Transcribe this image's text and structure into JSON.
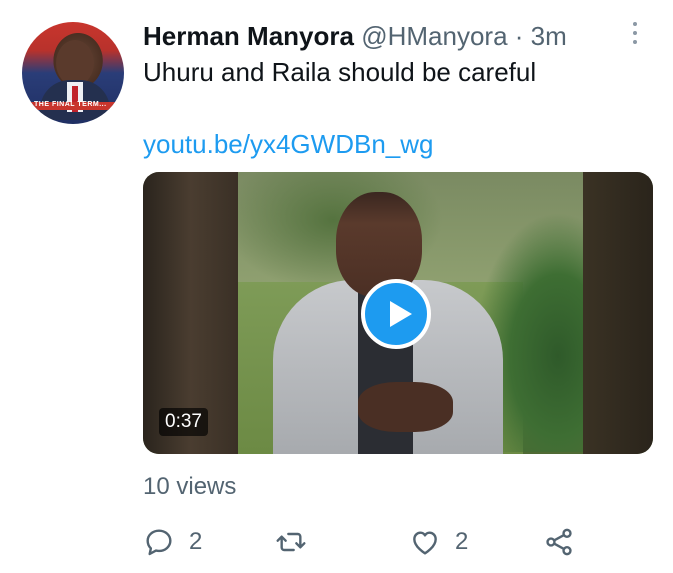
{
  "tweet": {
    "author_name": "Herman Manyora",
    "handle": "@HManyora",
    "separator": "·",
    "time": "3m",
    "text": "Uhuru and Raila should be careful",
    "link": "youtu.be/yx4GWDBn_wg",
    "avatar_banner": "THE FINAL TERM..."
  },
  "media": {
    "duration": "0:37"
  },
  "stats": {
    "views": "10 views"
  },
  "actions": {
    "reply_count": "2",
    "retweet_count": "",
    "like_count": "2"
  },
  "icons": {
    "more": "more-vertical-icon",
    "reply": "reply-icon",
    "retweet": "retweet-icon",
    "like": "heart-icon",
    "share": "share-icon",
    "play": "play-icon"
  },
  "colors": {
    "accent": "#1d9bf0",
    "secondary_text": "#536471",
    "primary_text": "#0f1419"
  }
}
